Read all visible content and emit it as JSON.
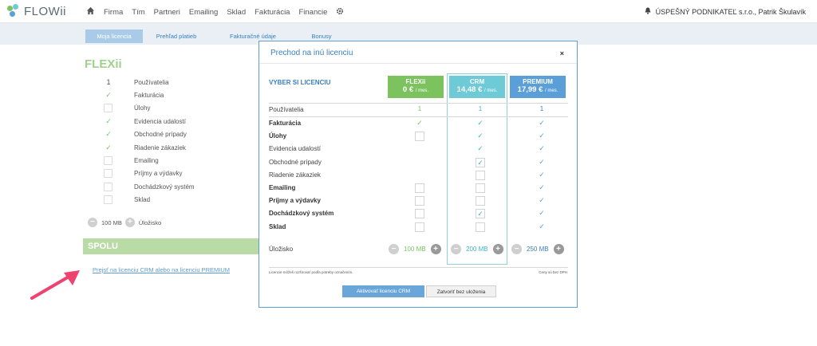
{
  "app": {
    "logo_text": "FLOWii"
  },
  "nav": {
    "items": [
      "Firma",
      "Tím",
      "Partneri",
      "Emailing",
      "Sklad",
      "Fakturácia",
      "Financie"
    ]
  },
  "top_right": {
    "company_user": "ÚSPEŠNÝ PODNIKATEĽ s.r.o., Patrik Škulavík"
  },
  "subtabs": [
    {
      "label": "Moja licencia",
      "active": true
    },
    {
      "label": "Prehľad platieb",
      "active": false
    },
    {
      "label": "Fakturačné údaje",
      "active": false
    },
    {
      "label": "Bonusy",
      "active": false
    }
  ],
  "background": {
    "title": "FLEXii",
    "rows": [
      {
        "mark": "1",
        "label": "Používatelia"
      },
      {
        "mark": "check",
        "label": "Fakturácia"
      },
      {
        "mark": "box",
        "label": "Úlohy"
      },
      {
        "mark": "check",
        "label": "Evidencia udalostí"
      },
      {
        "mark": "check",
        "label": "Obchodné prípady"
      },
      {
        "mark": "check",
        "label": "Riadenie zákaziek"
      },
      {
        "mark": "box",
        "label": "Emailing"
      },
      {
        "mark": "box",
        "label": "Príjmy a výdavky"
      },
      {
        "mark": "box",
        "label": "Dochádzkový systém"
      },
      {
        "mark": "box",
        "label": "Sklad"
      }
    ],
    "storage_value": "100 MB",
    "storage_label": "Úložisko",
    "spolu": "SPOLU",
    "link": "Prejsť na licenciu CRM alebo na licenciu PREMIUM"
  },
  "modal": {
    "title": "Prechod na inú licenciu",
    "close": "×",
    "choose_label": "VYBER SI LICENCIU",
    "plans": [
      {
        "name": "FLEXii",
        "price": "0 €",
        "unit": "/ mes.",
        "color": "#7cc35f"
      },
      {
        "name": "CRM",
        "price": "14,48 €",
        "unit": "/ mes.",
        "color": "#6ecad7"
      },
      {
        "name": "PREMIUM",
        "price": "17,99 €",
        "unit": "/ mes.",
        "color": "#5b9fd8"
      }
    ],
    "users_label": "Používatelia",
    "users": [
      "1",
      "1",
      "1"
    ],
    "features": [
      {
        "label": "Fakturácia",
        "bold": true,
        "cells": [
          "check",
          "check",
          "check"
        ]
      },
      {
        "label": "Úlohy",
        "bold": true,
        "cells": [
          "box",
          "check",
          "check"
        ]
      },
      {
        "label": "Evidencia udalostí",
        "bold": false,
        "cells": [
          "",
          "check",
          "check"
        ]
      },
      {
        "label": "Obchodné prípady",
        "bold": false,
        "cells": [
          "",
          "boxcheck",
          "check"
        ]
      },
      {
        "label": "Riadenie zákaziek",
        "bold": false,
        "cells": [
          "",
          "box",
          "check"
        ]
      },
      {
        "label": "Emailing",
        "bold": true,
        "cells": [
          "box",
          "box",
          "check"
        ]
      },
      {
        "label": "Príjmy a výdavky",
        "bold": true,
        "cells": [
          "box",
          "box",
          "check"
        ]
      },
      {
        "label": "Dochádzkový systém",
        "bold": true,
        "cells": [
          "box",
          "boxcheck",
          "check"
        ]
      },
      {
        "label": "Sklad",
        "bold": true,
        "cells": [
          "box",
          "box",
          "check"
        ]
      }
    ],
    "storage_label": "Úložisko",
    "storage": [
      "100 MB",
      "200 MB",
      "250 MB"
    ],
    "note_left": "Licencie môžeš rozširovať podľa potreby označením.",
    "note_right": "Ceny sú bez DPH",
    "activate_button": "Aktivovať licenciu CRM",
    "close_button": "Zatvoriť bez uloženia"
  },
  "colors": {
    "accent": "#5e9fd6",
    "flexii": "#7cc35f",
    "crm": "#6ecad7",
    "premium": "#5b9fd8",
    "arrow": "#f0426f"
  }
}
